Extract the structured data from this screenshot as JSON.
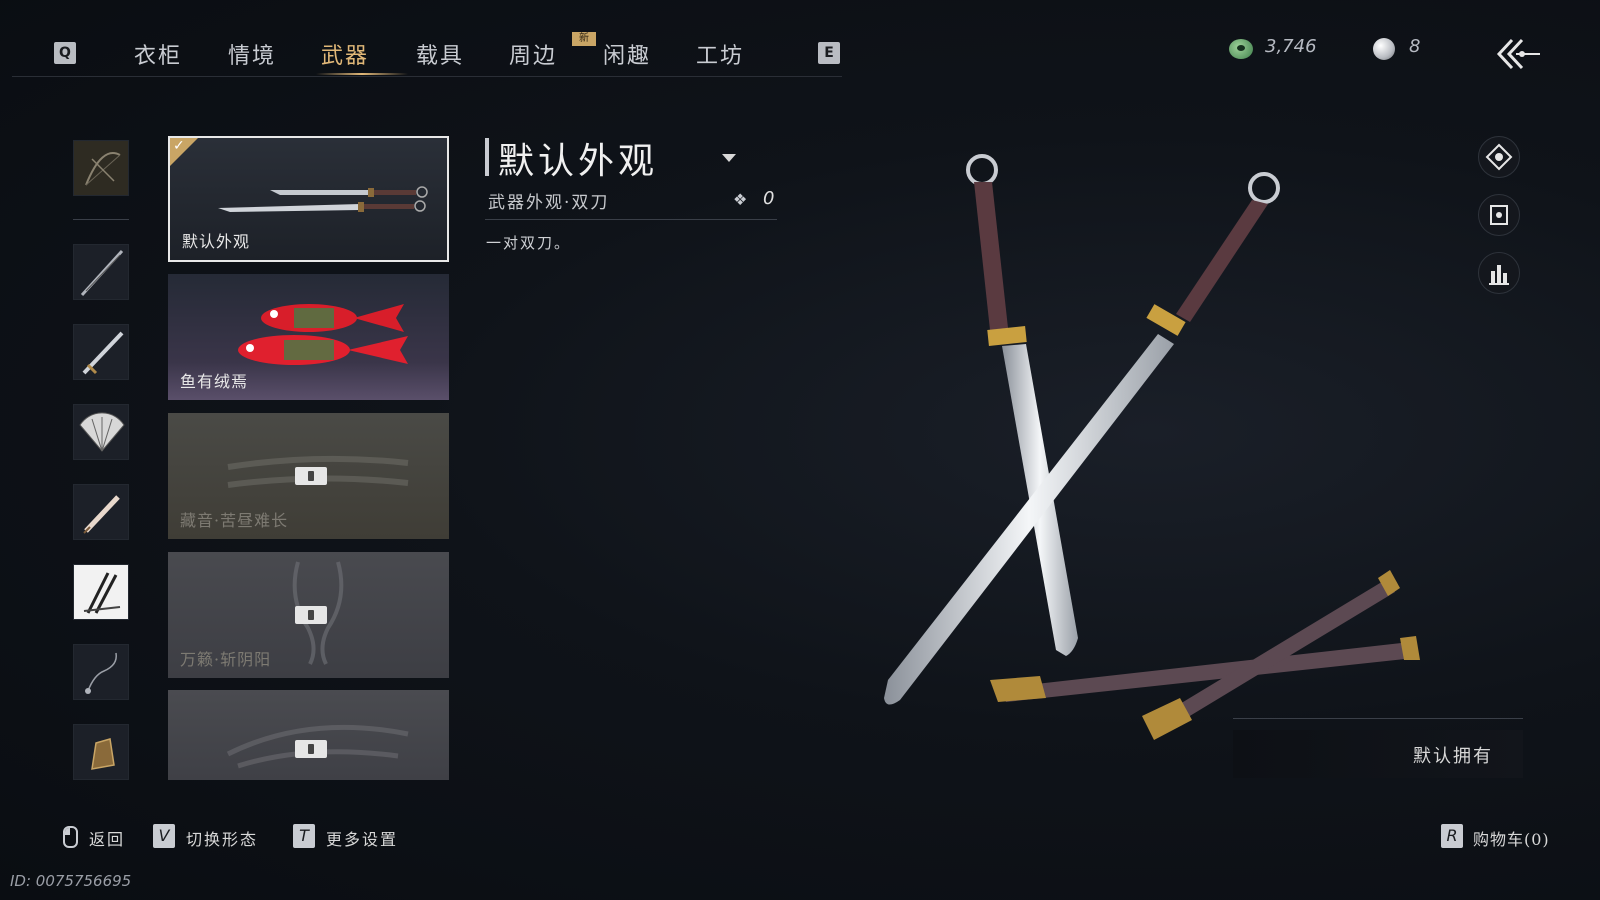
{
  "nav": {
    "key_left": "Q",
    "key_right": "E",
    "tabs": [
      {
        "label": "衣柜"
      },
      {
        "label": "情境"
      },
      {
        "label": "武器"
      },
      {
        "label": "载具"
      },
      {
        "label": "周边"
      },
      {
        "label": "闲趣"
      },
      {
        "label": "工坊"
      }
    ],
    "active_tab": "武器",
    "new_badge": "新"
  },
  "currency": {
    "jade_amount": "3,746",
    "pearl_amount": "8"
  },
  "skins": [
    {
      "label": "默认外观",
      "selected": true,
      "locked": false
    },
    {
      "label": "鱼有绒焉",
      "selected": false,
      "locked": false
    },
    {
      "label": "藏音·苦昼难长",
      "selected": false,
      "locked": true
    },
    {
      "label": "万籁·斩阴阳",
      "selected": false,
      "locked": true
    },
    {
      "label": "",
      "selected": false,
      "locked": true
    }
  ],
  "detail": {
    "title": "默认外观",
    "subtitle": "武器外观·双刀",
    "flower_count": "0",
    "description": "一对双刀。"
  },
  "owned": {
    "label": "默认拥有"
  },
  "bottom": {
    "back_label": "返回",
    "switch_key": "V",
    "switch_label": "切换形态",
    "settings_key": "T",
    "settings_label": "更多设置",
    "cart_key": "R",
    "cart_label": "购物车(0)"
  },
  "uid": "ID: 0075756695",
  "colors": {
    "accent_gold": "#e1b878",
    "badge_gold": "#c9a565",
    "background": "#0f1319"
  }
}
